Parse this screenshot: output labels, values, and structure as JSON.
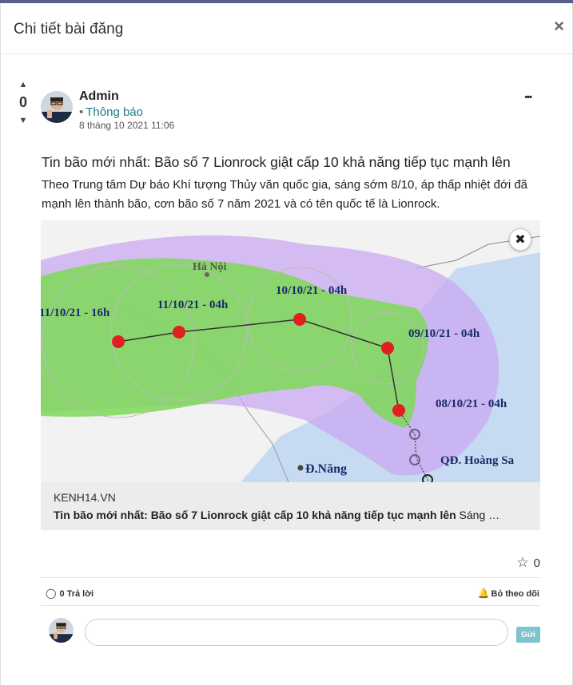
{
  "modal": {
    "title": "Chi tiết bài đăng",
    "close_label": "×"
  },
  "vote": {
    "up": "▲",
    "count": "0",
    "down": "▼"
  },
  "post": {
    "author": "Admin",
    "category_bullet": "•",
    "category": "Thông báo",
    "date": "8 tháng 10 2021 11:06",
    "more_label": "•••",
    "title": "Tin bão mới nhất: Bão số 7 Lionrock giật cấp 10 khả năng tiếp tục mạnh lên",
    "body": " Theo Trung tâm Dự báo Khí tượng Thủy văn quốc gia, sáng sớm 8/10, áp thấp nhiệt đới đã mạnh lên thành bão, cơn bão số 7 năm 2021 và có tên quốc tế là Lionrock."
  },
  "link_card": {
    "close_label": "✖",
    "source": "KENH14.VN",
    "headline_bold": "Tin bão mới nhất: Bão số 7 Lionrock giật cấp 10 khả năng tiếp tục mạnh lên",
    "headline_rest": " Sáng …",
    "map": {
      "city_hanoi": "Hà Nội",
      "city_danang": "Đ.Năng",
      "islands": "QĐ. Hoàng Sa",
      "forecast_labels": [
        "11/10/21 - 16h",
        "11/10/21 - 04h",
        "10/10/21 - 04h",
        "09/10/21 - 04h",
        "08/10/21 - 04h"
      ]
    }
  },
  "reactions": {
    "star_icon": "☆",
    "like_count": "0"
  },
  "footer": {
    "reply_icon": "◯",
    "reply_label": "0 Trả lời",
    "follow_icon": "🔔",
    "follow_label": "Bỏ theo dõi"
  },
  "comment": {
    "input_value": "",
    "placeholder": "",
    "send_label": "Gửi"
  },
  "colors": {
    "accent": "#1d7a8c",
    "send_button": "#7ec3d0",
    "follow_bell": "#2aa77e",
    "cone_green": "#7ed957",
    "cone_purple": "#c9a8f0"
  }
}
